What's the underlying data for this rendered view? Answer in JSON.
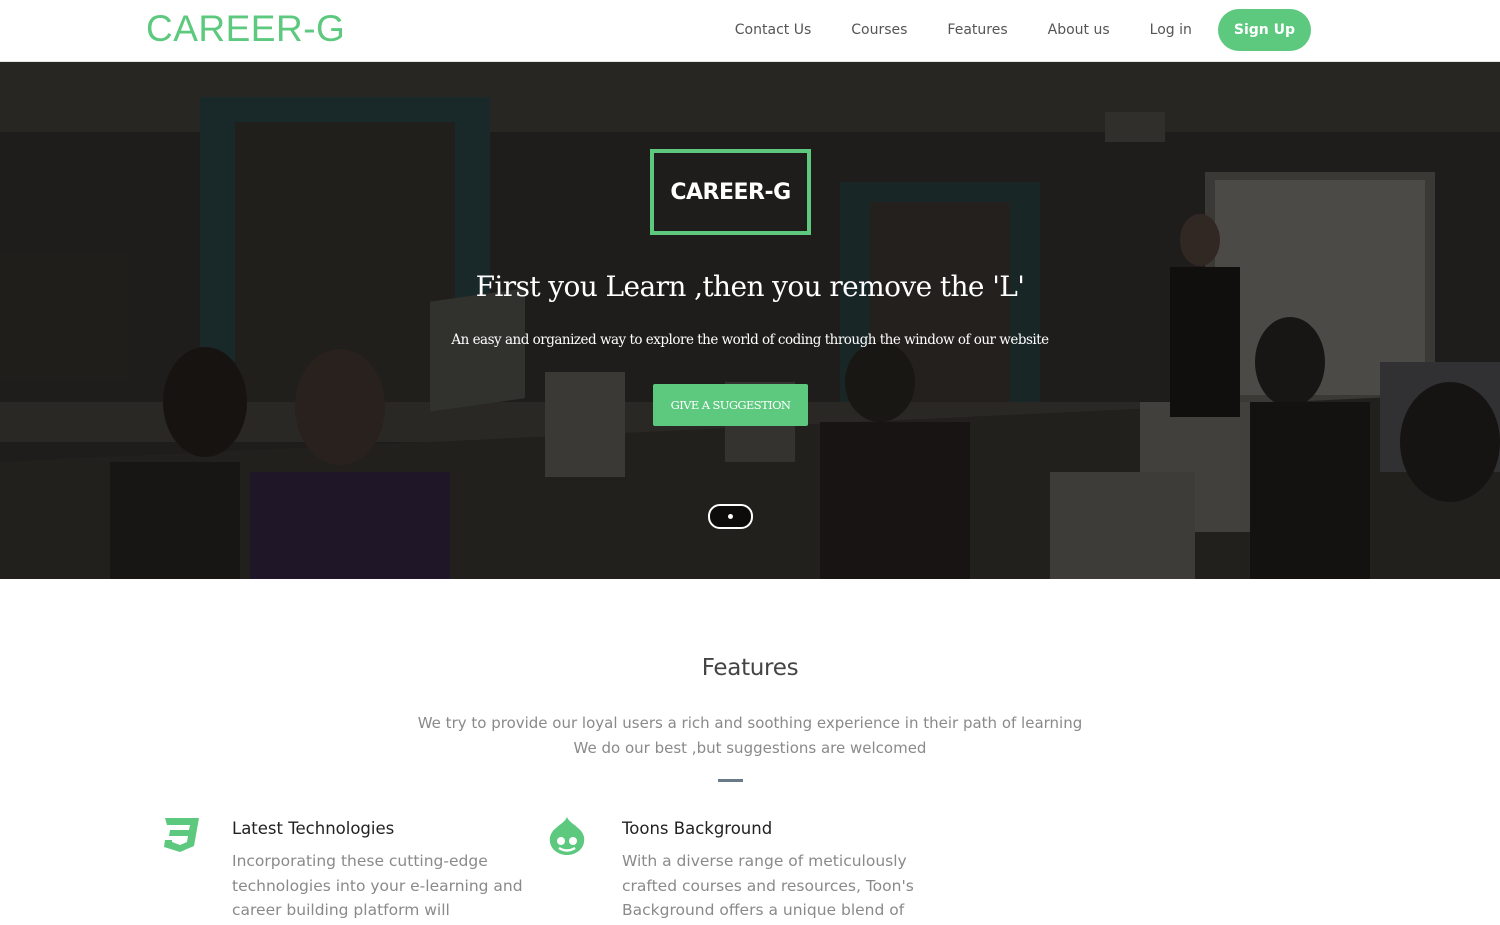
{
  "navbar": {
    "brand": "CAREER-G",
    "links": [
      "Contact Us",
      "Courses",
      "Features",
      "About us",
      "Log in"
    ],
    "signup": "Sign Up",
    "accent_color": "#5cc97f"
  },
  "hero": {
    "logo_text": "CAREER-G",
    "title": "First you Learn ,then you remove the 'L'",
    "subtitle": "An easy and organized way to explore the world of coding through the window of our website",
    "button": "GIVE A SUGGESTION"
  },
  "features": {
    "title": "Features",
    "desc_line1": "We try to provide our loyal users a rich and soothing experience in their path of learning",
    "desc_line2": "We do our best ,but suggestions are welcomed",
    "items": [
      {
        "icon": "css3-icon",
        "title": "Latest Technologies",
        "line1": "Incorporating these cutting-edge",
        "line2": "technologies into your e-learning and",
        "line3": "career building platform will"
      },
      {
        "icon": "drupal-icon",
        "title": "Toons Background",
        "line1": "With a diverse range of meticulously",
        "line2": "crafted courses and resources, Toon's",
        "line3": "Background offers a unique blend of"
      }
    ]
  }
}
